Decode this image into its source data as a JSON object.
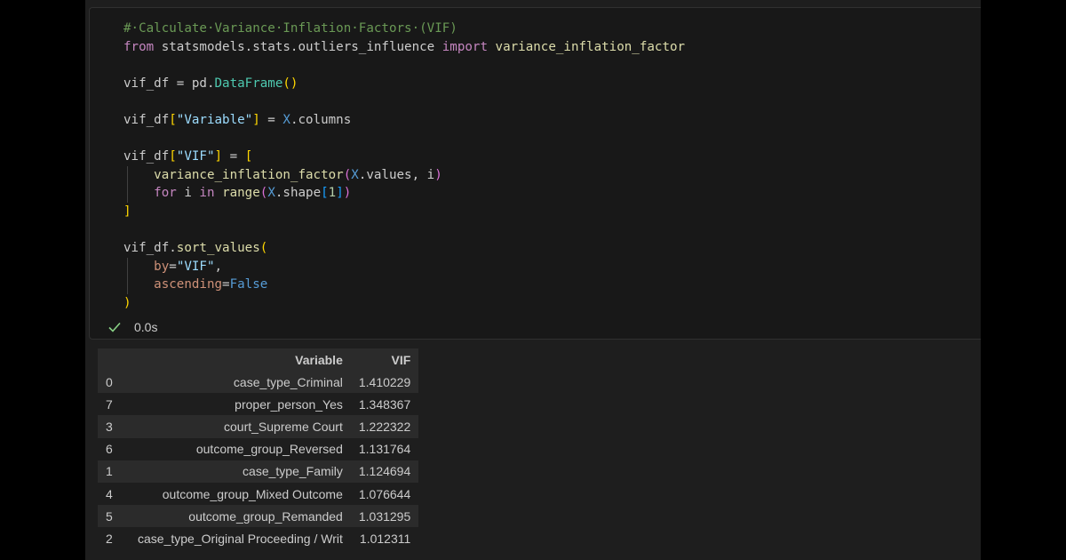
{
  "code": {
    "lines": [
      {
        "segments": [
          {
            "t": "#·Calculate·Variance·Inflation·Factors·(VIF)",
            "c": "cm"
          }
        ]
      },
      {
        "segments": [
          {
            "t": "from",
            "c": "kw"
          },
          {
            "t": " statsmodels.stats.outliers_influence ",
            "c": "dim"
          },
          {
            "t": "import",
            "c": "kw"
          },
          {
            "t": " variance_inflation_factor",
            "c": "fn"
          }
        ]
      },
      {
        "segments": []
      },
      {
        "segments": [
          {
            "t": "vif_df",
            "c": "dim"
          },
          {
            "t": " = ",
            "c": "dim"
          },
          {
            "t": "pd",
            "c": "dim"
          },
          {
            "t": ".",
            "c": "dim"
          },
          {
            "t": "DataFrame",
            "c": "cls"
          },
          {
            "t": "()",
            "c": "b1"
          }
        ]
      },
      {
        "segments": []
      },
      {
        "segments": [
          {
            "t": "vif_df",
            "c": "dim"
          },
          {
            "t": "[",
            "c": "b1"
          },
          {
            "t": "\"Variable\"",
            "c": "var"
          },
          {
            "t": "]",
            "c": "b1"
          },
          {
            "t": " = ",
            "c": "dim"
          },
          {
            "t": "X",
            "c": "const"
          },
          {
            "t": ".columns",
            "c": "dim"
          }
        ]
      },
      {
        "segments": []
      },
      {
        "segments": [
          {
            "t": "vif_df",
            "c": "dim"
          },
          {
            "t": "[",
            "c": "b1"
          },
          {
            "t": "\"VIF\"",
            "c": "var"
          },
          {
            "t": "]",
            "c": "b1"
          },
          {
            "t": " = ",
            "c": "dim"
          },
          {
            "t": "[",
            "c": "b1"
          }
        ]
      },
      {
        "segments": [
          {
            "t": "    ",
            "c": "dim"
          },
          {
            "t": "variance_inflation_factor",
            "c": "fn"
          },
          {
            "t": "(",
            "c": "b2"
          },
          {
            "t": "X",
            "c": "const"
          },
          {
            "t": ".values, i",
            "c": "dim"
          },
          {
            "t": ")",
            "c": "b2"
          }
        ]
      },
      {
        "segments": [
          {
            "t": "    ",
            "c": "dim"
          },
          {
            "t": "for",
            "c": "kw"
          },
          {
            "t": " i ",
            "c": "dim"
          },
          {
            "t": "in",
            "c": "kw"
          },
          {
            "t": " ",
            "c": "dim"
          },
          {
            "t": "range",
            "c": "fn"
          },
          {
            "t": "(",
            "c": "b2"
          },
          {
            "t": "X",
            "c": "const"
          },
          {
            "t": ".shape",
            "c": "dim"
          },
          {
            "t": "[",
            "c": "b3"
          },
          {
            "t": "1",
            "c": "num"
          },
          {
            "t": "]",
            "c": "b3"
          },
          {
            "t": ")",
            "c": "b2"
          }
        ]
      },
      {
        "segments": [
          {
            "t": "]",
            "c": "b1"
          }
        ]
      },
      {
        "segments": []
      },
      {
        "segments": [
          {
            "t": "vif_df",
            "c": "dim"
          },
          {
            "t": ".",
            "c": "dim"
          },
          {
            "t": "sort_values",
            "c": "fn"
          },
          {
            "t": "(",
            "c": "b1"
          }
        ]
      },
      {
        "segments": [
          {
            "t": "    ",
            "c": "dim"
          },
          {
            "t": "by",
            "c": "str"
          },
          {
            "t": "=",
            "c": "dim"
          },
          {
            "t": "\"VIF\"",
            "c": "var"
          },
          {
            "t": ",",
            "c": "dim"
          }
        ]
      },
      {
        "segments": [
          {
            "t": "    ",
            "c": "dim"
          },
          {
            "t": "ascending",
            "c": "str"
          },
          {
            "t": "=",
            "c": "dim"
          },
          {
            "t": "False",
            "c": "const"
          }
        ]
      },
      {
        "segments": [
          {
            "t": ")",
            "c": "b1"
          }
        ]
      }
    ]
  },
  "status": {
    "icon": "check-icon",
    "time": "0.0s",
    "color": "#89d185"
  },
  "output_table": {
    "columns": [
      "",
      "Variable",
      "VIF"
    ],
    "rows": [
      [
        "0",
        "case_type_Criminal",
        "1.410229"
      ],
      [
        "7",
        "proper_person_Yes",
        "1.348367"
      ],
      [
        "3",
        "court_Supreme Court",
        "1.222322"
      ],
      [
        "6",
        "outcome_group_Reversed",
        "1.131764"
      ],
      [
        "1",
        "case_type_Family",
        "1.124694"
      ],
      [
        "4",
        "outcome_group_Mixed Outcome",
        "1.076644"
      ],
      [
        "5",
        "outcome_group_Remanded",
        "1.031295"
      ],
      [
        "2",
        "case_type_Original Proceeding / Writ",
        "1.012311"
      ]
    ]
  }
}
